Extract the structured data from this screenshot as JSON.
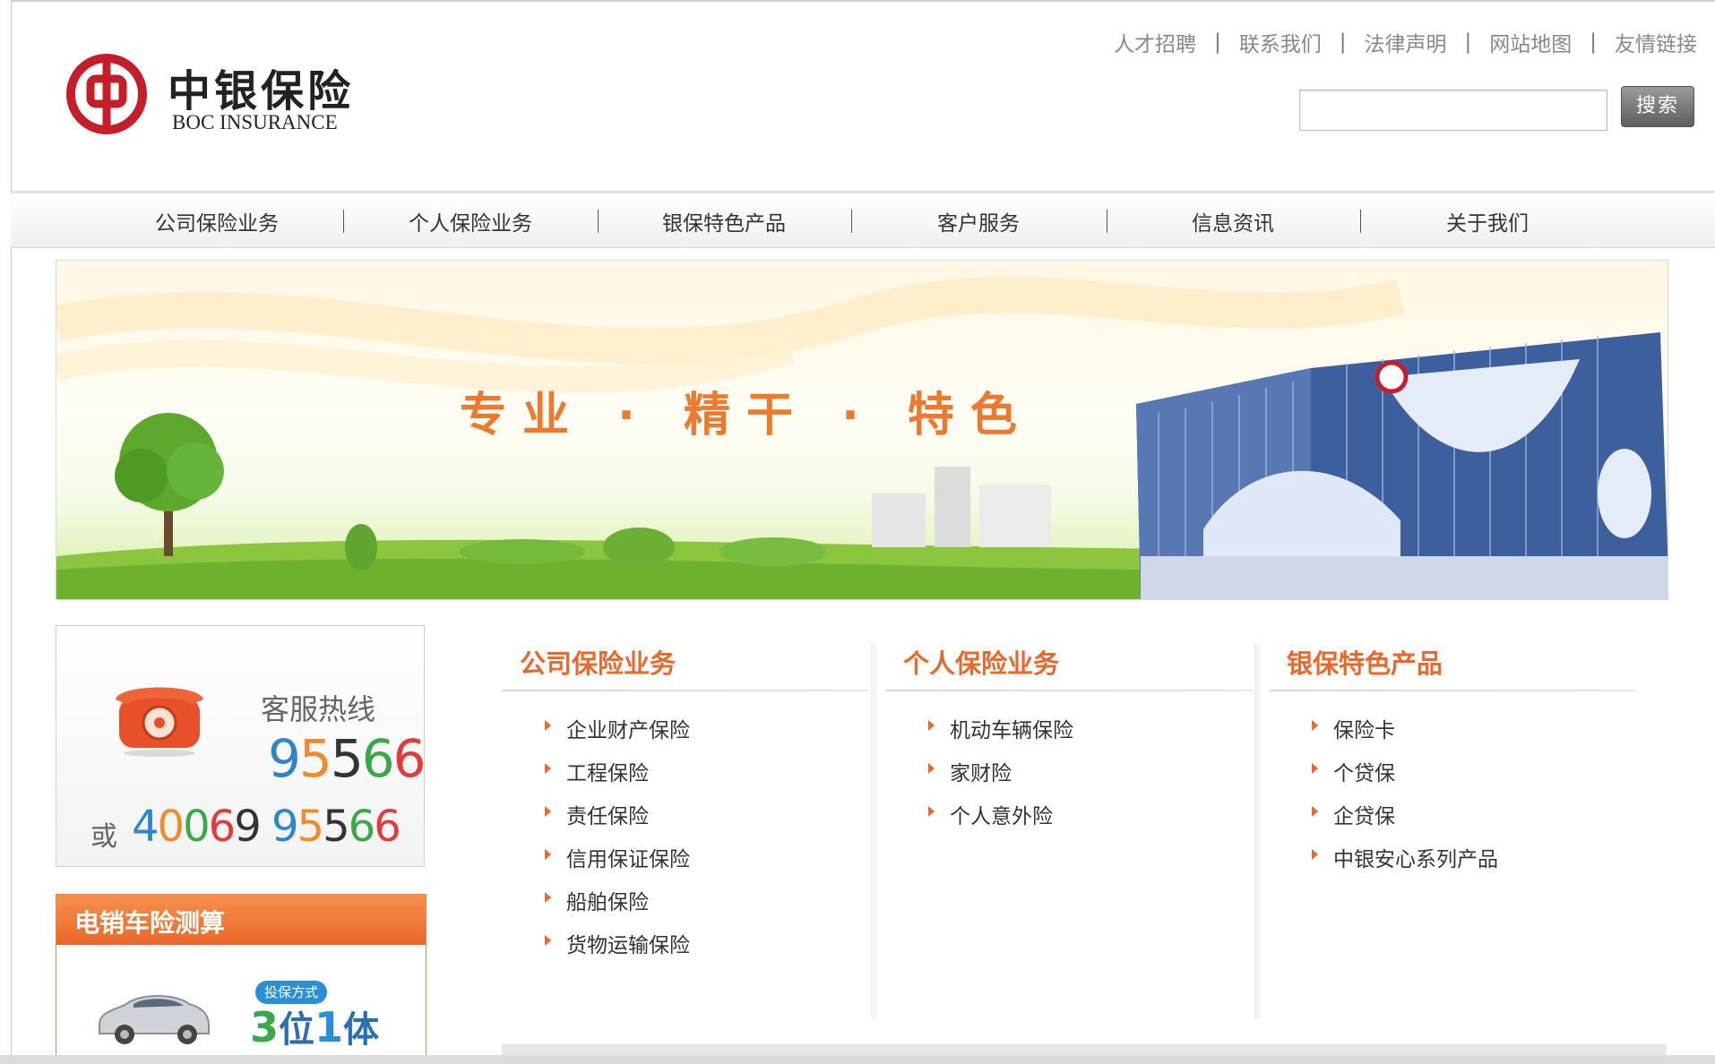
{
  "logo": {
    "name_cn": "中银保险",
    "name_en": "BOC INSURANCE",
    "brand_color": "#c41e2b"
  },
  "top_links": [
    "人才招聘",
    "联系我们",
    "法律声明",
    "网站地图",
    "友情链接"
  ],
  "top_link_separator": "|",
  "search": {
    "button_label": "搜索",
    "value": ""
  },
  "nav": {
    "items": [
      "公司保险业务",
      "个人保险业务",
      "银保特色产品",
      "客户服务",
      "信息资讯",
      "关于我们"
    ],
    "separator": "|"
  },
  "banner": {
    "slogan": "专业 · 精干 · 特色"
  },
  "hotline": {
    "label": "客服热线",
    "number": "95566",
    "alt_prefix": "或",
    "alt_number": "4006995566",
    "alt_number_part1": "40069",
    "alt_number_part2": "95566",
    "icon": "telephone-icon"
  },
  "calculator": {
    "title": "电销车险测算",
    "badge_top": "投保方式",
    "badge_main": "3位1体",
    "badge_digit1": "3",
    "badge_char1": "位",
    "badge_digit2": "1",
    "badge_char2": "体",
    "icon": "car-icon"
  },
  "columns": [
    {
      "title": "公司保险业务",
      "items": [
        "企业财产保险",
        "工程保险",
        "责任保险",
        "信用保证保险",
        "船舶保险",
        "货物运输保险"
      ]
    },
    {
      "title": "个人保险业务",
      "items": [
        "机动车辆保险",
        "家财险",
        "个人意外险"
      ]
    },
    {
      "title": "银保特色产品",
      "items": [
        "保险卡",
        "个贷保",
        "企贷保",
        "中银安心系列产品"
      ]
    }
  ],
  "colors": {
    "accent": "#e8692d",
    "nav_text": "#333333",
    "link_gray": "#888888"
  }
}
